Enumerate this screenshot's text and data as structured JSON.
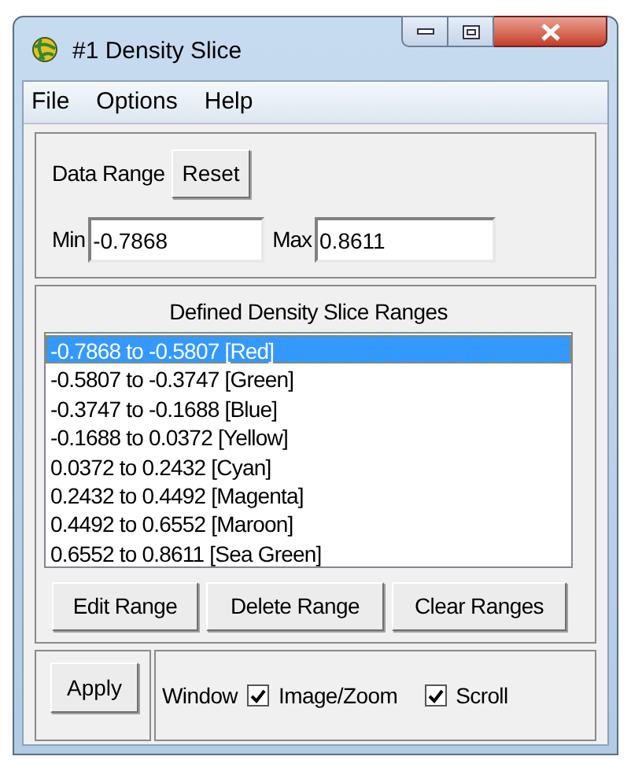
{
  "window": {
    "title": "#1 Density Slice"
  },
  "menu": [
    "File",
    "Options",
    "Help"
  ],
  "data_range": {
    "label": "Data Range",
    "reset_button": "Reset",
    "min": {
      "label": "Min",
      "value": "-0.7868"
    },
    "max": {
      "label": "Max",
      "value": "0.8611"
    }
  },
  "ranges": {
    "title": "Defined Density Slice Ranges",
    "items": [
      {
        "label": "-0.7868 to -0.5807 [Red]",
        "selected": true
      },
      {
        "label": "-0.5807 to -0.3747 [Green]",
        "selected": false
      },
      {
        "label": "-0.3747 to -0.1688 [Blue]",
        "selected": false
      },
      {
        "label": "-0.1688 to 0.0372 [Yellow]",
        "selected": false
      },
      {
        "label": "0.0372 to 0.2432 [Cyan]",
        "selected": false
      },
      {
        "label": "0.2432 to 0.4492 [Magenta]",
        "selected": false
      },
      {
        "label": "0.4492 to 0.6552 [Maroon]",
        "selected": false
      },
      {
        "label": "0.6552 to 0.8611 [Sea Green]",
        "selected": false
      }
    ],
    "buttons": [
      "Edit Range",
      "Delete Range",
      "Clear Ranges"
    ]
  },
  "apply_button": "Apply",
  "window_options": {
    "label": "Window",
    "options": [
      {
        "label": "Image/Zoom",
        "checked": true
      },
      {
        "label": "Scroll",
        "checked": true
      }
    ]
  }
}
